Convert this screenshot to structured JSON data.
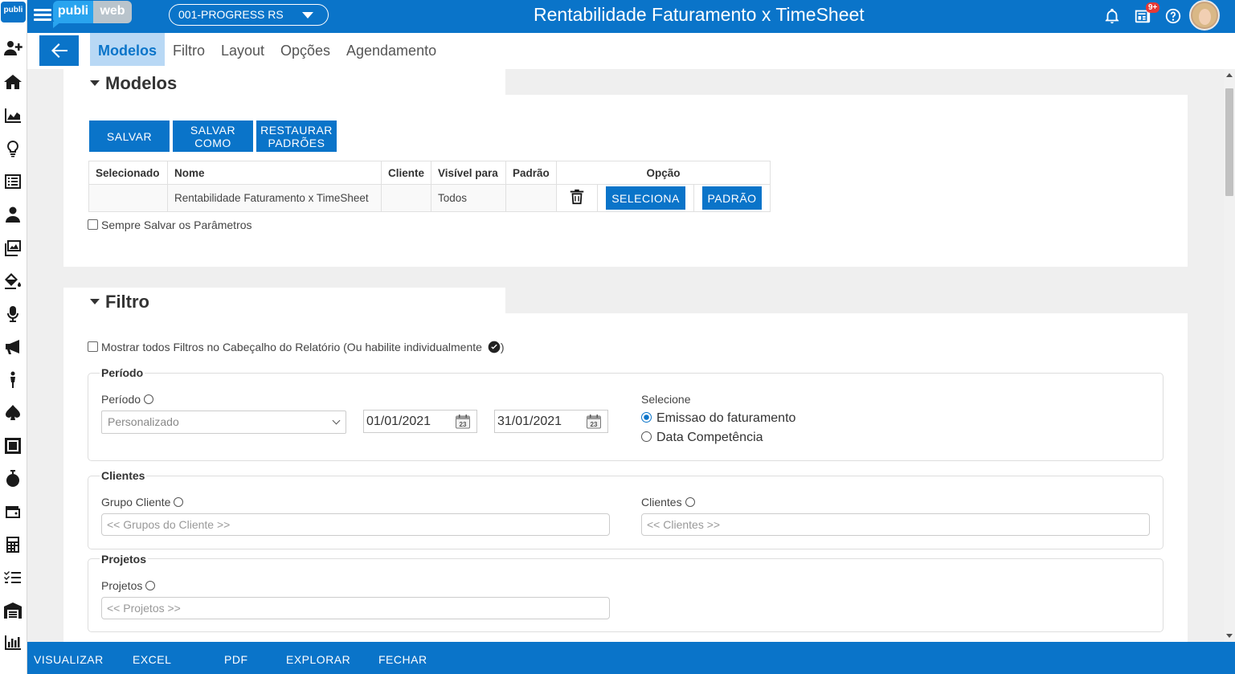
{
  "header": {
    "brand_left": "publi",
    "brand_right": "web",
    "rail_logo": "publi",
    "company_select": "001-PROGRESS RS",
    "page_title": "Rentabilidade Faturamento x TimeSheet",
    "notification_badge": "9+",
    "icons": [
      "bell-icon",
      "news-icon",
      "help-icon",
      "avatar"
    ]
  },
  "tabs": [
    {
      "label": "Modelos",
      "active": true
    },
    {
      "label": "Filtro"
    },
    {
      "label": "Layout"
    },
    {
      "label": "Opções"
    },
    {
      "label": "Agendamento"
    }
  ],
  "modelos": {
    "title": "Modelos",
    "buttons": {
      "save": "SALVAR",
      "save_as": "SALVAR COMO",
      "restore": "RESTAURAR PADRÕES"
    },
    "table": {
      "headers": [
        "Selecionado",
        "Nome",
        "Cliente",
        "Visível para",
        "Padrão",
        "Opção"
      ],
      "rows": [
        {
          "selecionado": "",
          "nome": "Rentabilidade Faturamento x TimeSheet",
          "cliente": "",
          "visivel": "Todos",
          "padrao": "",
          "select_button": "SELECIONA",
          "default_button": "PADRÃO"
        }
      ]
    },
    "always_save_label": "Sempre Salvar os Parâmetros"
  },
  "filtro": {
    "title": "Filtro",
    "show_all_label": "Mostrar todos Filtros no Cabeçalho do Relatório (Ou habilite individualmente",
    "show_all_suffix": ")",
    "periodo": {
      "legend": "Período",
      "field_label": "Período",
      "select_value": "Personalizado",
      "date_from": "01/01/2021",
      "date_to": "31/01/2021",
      "calendar_day": "23",
      "selecione_label": "Selecione",
      "options": [
        {
          "label": "Emissao do faturamento",
          "checked": true
        },
        {
          "label": "Data Competência",
          "checked": false
        }
      ]
    },
    "clientes": {
      "legend": "Clientes",
      "grupo_label": "Grupo Cliente",
      "grupo_placeholder": "<< Grupos do Cliente >>",
      "clientes_label": "Clientes",
      "clientes_placeholder": "<< Clientes >>"
    },
    "projetos": {
      "legend": "Projetos",
      "label": "Projetos",
      "placeholder": "<< Projetos >>"
    }
  },
  "footer": {
    "visualizar": "VISUALIZAR",
    "excel": "EXCEL",
    "pdf": "PDF",
    "explorar": "EXPLORAR",
    "fechar": "FECHAR"
  },
  "colors": {
    "primary": "#0a74c9",
    "active_tab_bg": "#b8d8f5",
    "brand_light": "#29a4ef",
    "content_bg": "#efefef"
  }
}
